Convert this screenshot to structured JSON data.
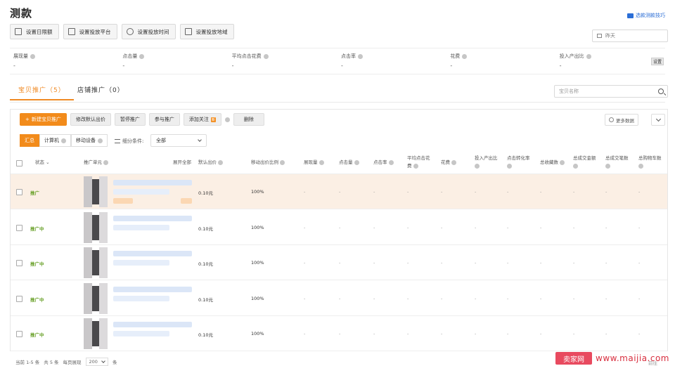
{
  "page_title": "测款",
  "guide_link": "选款测款技巧",
  "toolbar": [
    {
      "label": "设置日限额",
      "icon": "calendar-icon"
    },
    {
      "label": "设置投放平台",
      "icon": "monitor-icon"
    },
    {
      "label": "设置投放时间",
      "icon": "clock-icon"
    },
    {
      "label": "设置投放地域",
      "icon": "location-icon"
    }
  ],
  "date_filter": "昨天",
  "stats": [
    {
      "label": "展现量",
      "value": "-"
    },
    {
      "label": "点击量",
      "value": "-"
    },
    {
      "label": "平均点击花费",
      "value": "-"
    },
    {
      "label": "点击率",
      "value": "-"
    },
    {
      "label": "花费",
      "value": "-"
    },
    {
      "label": "投入产出比",
      "value": "-"
    }
  ],
  "settings_label": "设置",
  "tabs": [
    {
      "label": "宝贝推广（5）",
      "active": true
    },
    {
      "label": "店铺推广（0）",
      "active": false
    }
  ],
  "search_placeholder": "宝贝名称",
  "actions": {
    "new": "新建宝贝推广",
    "modify_bid": "修改默认出价",
    "pause": "暂停推广",
    "join": "参与推广",
    "follow": "添加关注",
    "follow_badge": "新",
    "delete": "删除"
  },
  "more_data": "更多数据",
  "devices": [
    "汇总",
    "计算机",
    "移动设备"
  ],
  "segment_label": "细分条件:",
  "segment_value": "全部",
  "columns": {
    "status": "状态",
    "unit": "推广单元",
    "expand_all": "展开全部",
    "bid": "默认出价",
    "mobile_ratio": "移动出价比例",
    "impressions": "展现量",
    "clicks": "点击量",
    "ctr": "点击率",
    "avg_cpc_l1": "平均点击花",
    "avg_cpc_l2": "费",
    "cost": "花费",
    "roi": "投入产出比",
    "cvr": "点击转化率",
    "fav": "总收藏数",
    "gmv": "总成交金额",
    "orders": "总成交笔数",
    "cart": "总购物车数"
  },
  "rows": [
    {
      "status": "推广",
      "bid": "0.10元",
      "ratio": "100%",
      "dash": "-"
    },
    {
      "status": "推广中",
      "bid": "0.10元",
      "ratio": "100%",
      "dash": "-"
    },
    {
      "status": "推广中",
      "bid": "0.10元",
      "ratio": "100%",
      "dash": "-"
    },
    {
      "status": "推广中",
      "bid": "0.10元",
      "ratio": "100%",
      "dash": "-"
    },
    {
      "status": "推广中",
      "bid": "0.10元",
      "ratio": "100%",
      "dash": "-"
    }
  ],
  "footer": {
    "range": "当前 1-5 条",
    "total": "共 5 条",
    "per_page_label": "每页展现",
    "per_page": "200",
    "unit": "条"
  },
  "pager_next": "前往",
  "watermark": {
    "logo": "卖家网",
    "url": "www.maijia.com"
  },
  "colors": {
    "accent": "#f28b1b",
    "status": "#6aa12a",
    "link": "#2b6ed6"
  }
}
